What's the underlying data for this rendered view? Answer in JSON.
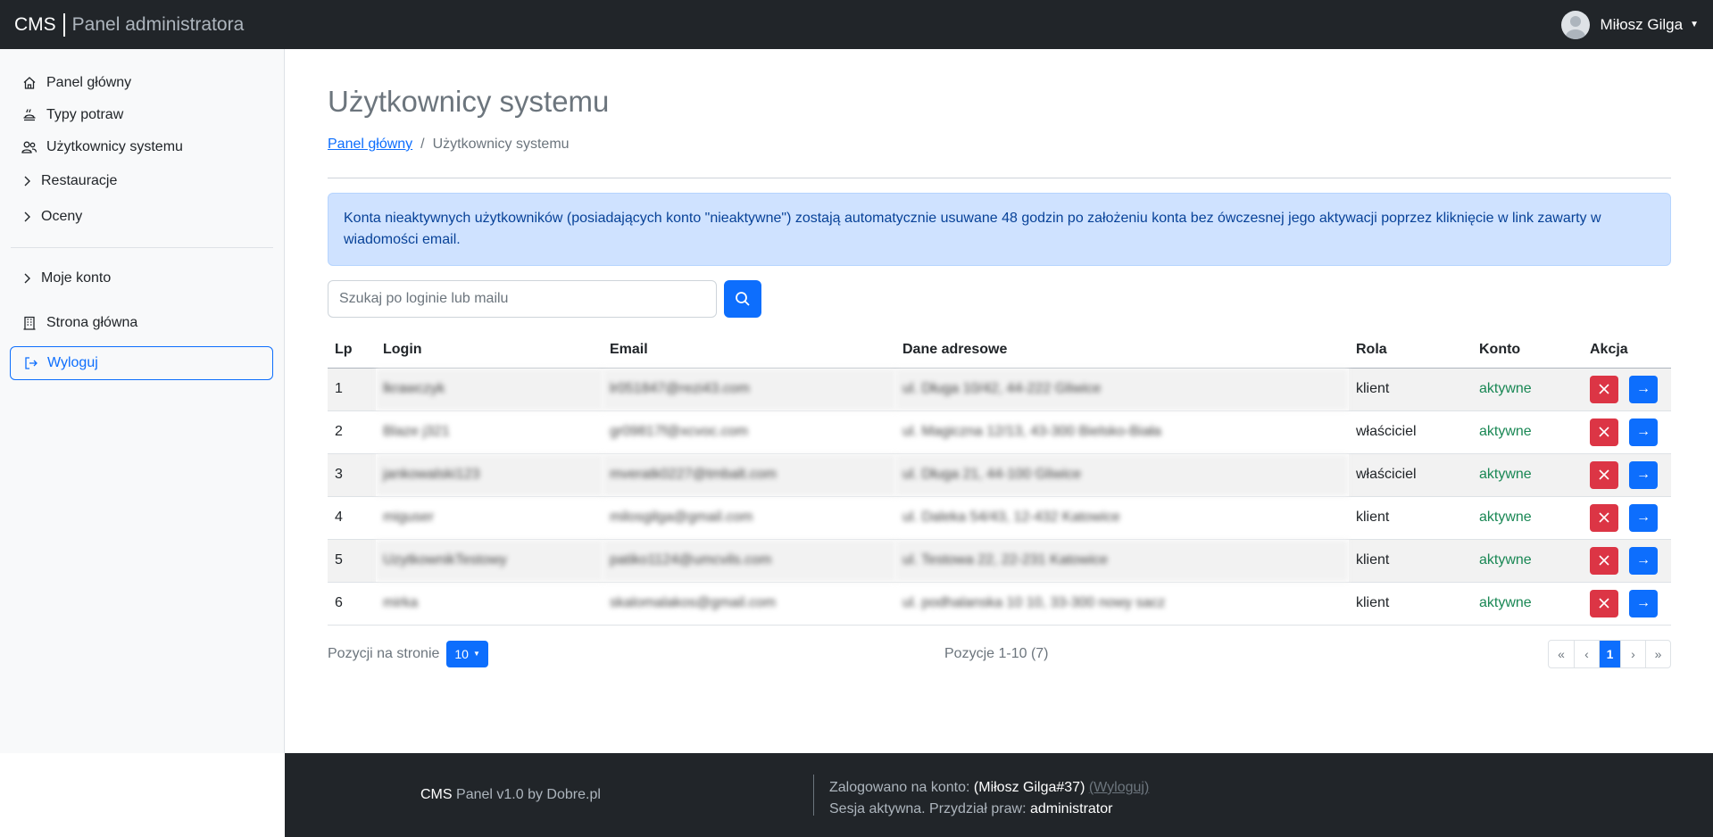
{
  "header": {
    "brand_cms": "CMS",
    "brand_panel": "Panel administratora",
    "user_name": "Miłosz Gilga"
  },
  "sidebar": {
    "items": [
      {
        "label": "Panel główny",
        "icon": "home-icon"
      },
      {
        "label": "Typy potraw",
        "icon": "dish-icon"
      },
      {
        "label": "Użytkownicy systemu",
        "icon": "users-icon"
      },
      {
        "label": "Restauracje",
        "icon": "chevron-right-icon"
      },
      {
        "label": "Oceny",
        "icon": "chevron-right-icon"
      },
      {
        "label": "Moje konto",
        "icon": "chevron-right-icon"
      },
      {
        "label": "Strona główna",
        "icon": "building-icon"
      }
    ],
    "logout_label": "Wyloguj"
  },
  "main": {
    "title": "Użytkownicy systemu",
    "breadcrumb": {
      "home": "Panel główny",
      "sep": "/",
      "current": "Użytkownicy systemu"
    },
    "alert": "Konta nieaktywnych użytkowników (posiadających konto \"nieaktywne\") zostają automatycznie usuwane 48 godzin po założeniu konta bez ówczesnej jego aktywacji poprzez kliknięcie w link zawarty w wiadomości email.",
    "search_placeholder": "Szukaj po loginie lub mailu",
    "table": {
      "headers": [
        "Lp",
        "Login",
        "Email",
        "Dane adresowe",
        "Rola",
        "Konto",
        "Akcja"
      ],
      "rows": [
        {
          "lp": "1",
          "login": "lkrawczyk",
          "email": "lr051847@rezi43.com",
          "address": "ul. Długa 10/42, 44-222 Gliwice",
          "role": "klient",
          "status": "aktywne"
        },
        {
          "lp": "2",
          "login": "Blaze j321",
          "email": "gr09817f@xcvoc.com",
          "address": "ul. Magiczna 12/13, 43-300 Bielsko-Biała",
          "role": "właściciel",
          "status": "aktywne"
        },
        {
          "lp": "3",
          "login": "jankowalski123",
          "email": "mveratk0227@tmbalt.com",
          "address": "ul. Długa 21, 44-100 Gliwice",
          "role": "właściciel",
          "status": "aktywne"
        },
        {
          "lp": "4",
          "login": "miguser",
          "email": "milosgilga@gmail.com",
          "address": "ul. Daleka 54/43, 12-432 Katowice",
          "role": "klient",
          "status": "aktywne"
        },
        {
          "lp": "5",
          "login": "UzytkownikTestowy",
          "email": "patiko1124@umcvils.com",
          "address": "ul. Testowa 22, 22-231 Katowice",
          "role": "klient",
          "status": "aktywne"
        },
        {
          "lp": "6",
          "login": "mirka",
          "email": "skalomalakos@gmail.com",
          "address": "ul. podhalanska 10 10, 33-300 nowy sacz",
          "role": "klient",
          "status": "aktywne"
        }
      ]
    },
    "pager": {
      "per_page_label": "Pozycji na stronie",
      "per_page_value": "10",
      "positions": "Pozycje 1-10 (7)",
      "current_page": "1"
    }
  },
  "footer": {
    "cms": "CMS",
    "panel_text": "Panel v1.0 by Dobre.pl",
    "logged_label": "Zalogowano na konto:",
    "logged_user": "(Miłosz Gilga#37)",
    "logout": "(Wyloguj)",
    "session_label": "Sesja aktywna. Przydział praw:",
    "session_role": "administrator"
  },
  "colors": {
    "primary": "#0d6efd",
    "danger": "#dc3545",
    "success": "#198754",
    "dark": "#212529"
  }
}
